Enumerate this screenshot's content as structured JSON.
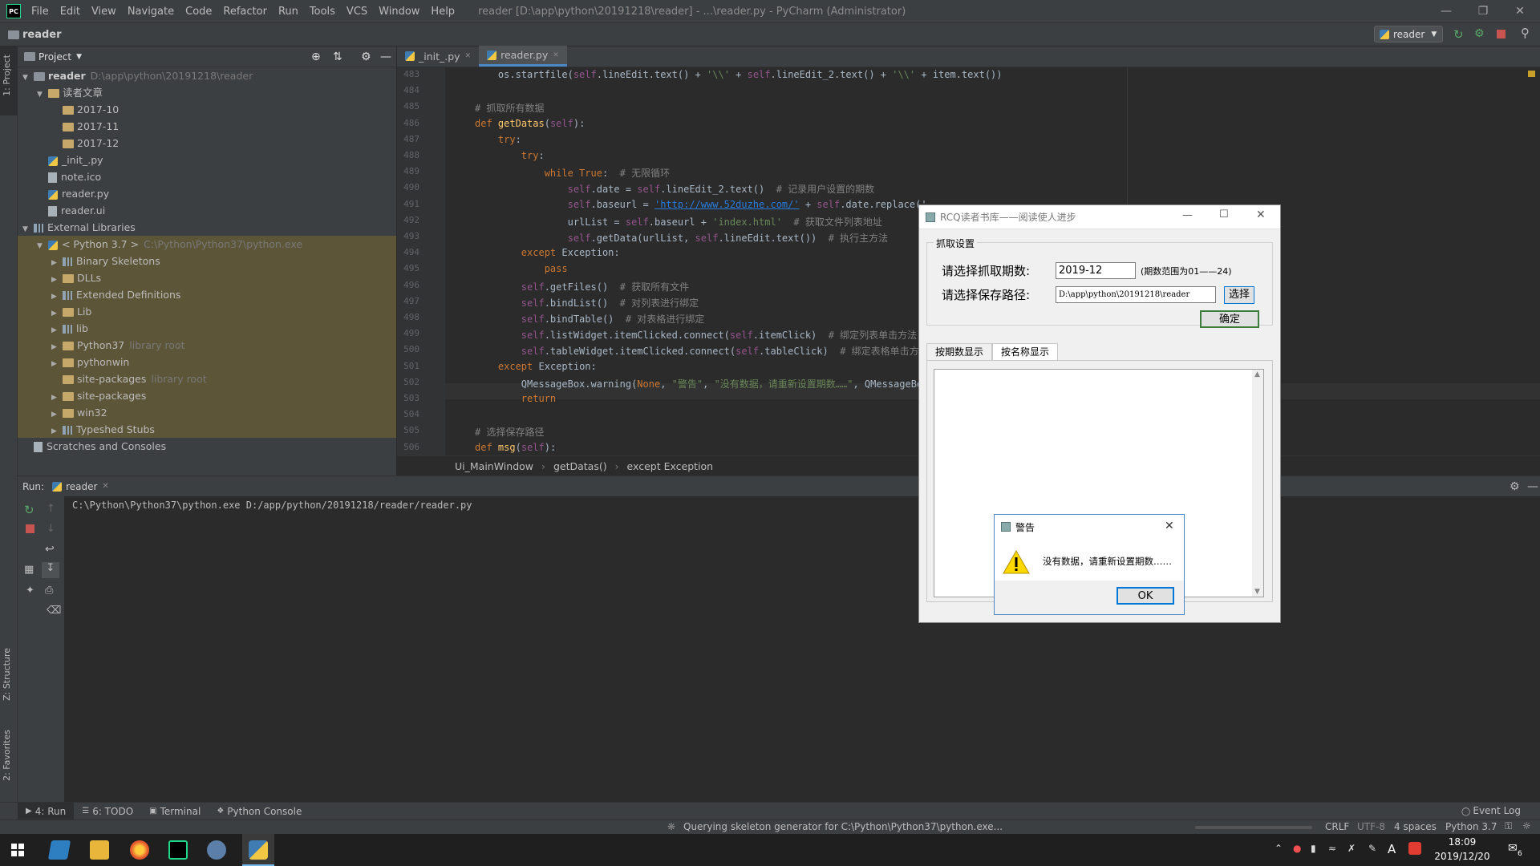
{
  "titlebar": {
    "app_icon": "PC",
    "menu": [
      "File",
      "Edit",
      "View",
      "Navigate",
      "Code",
      "Refactor",
      "Run",
      "Tools",
      "VCS",
      "Window",
      "Help"
    ],
    "window_title": "reader [D:\\app\\python\\20191218\\reader] - ...\\reader.py - PyCharm (Administrator)"
  },
  "navbar": {
    "project_name": "reader",
    "run_config": "reader"
  },
  "sidebar_tabs": {
    "project": "1: Project",
    "structure": "Z: Structure",
    "favorites": "2: Favorites"
  },
  "project_panel": {
    "header": "Project",
    "tree": [
      {
        "label": "reader",
        "extra": "D:\\app\\python\\20191218\\reader",
        "kind": "folder",
        "indent": 0,
        "arrow": "▼"
      },
      {
        "label": "读者文章",
        "kind": "folder",
        "indent": 1,
        "arrow": "▼"
      },
      {
        "label": "2017-10",
        "kind": "folder",
        "indent": 2,
        "arrow": ""
      },
      {
        "label": "2017-11",
        "kind": "folder",
        "indent": 2,
        "arrow": ""
      },
      {
        "label": "2017-12",
        "kind": "folder",
        "indent": 2,
        "arrow": ""
      },
      {
        "label": "_init_.py",
        "kind": "py",
        "indent": 1,
        "arrow": ""
      },
      {
        "label": "note.ico",
        "kind": "file",
        "indent": 1,
        "arrow": ""
      },
      {
        "label": "reader.py",
        "kind": "py",
        "indent": 1,
        "arrow": ""
      },
      {
        "label": "reader.ui",
        "kind": "file",
        "indent": 1,
        "arrow": ""
      },
      {
        "label": "External Libraries",
        "kind": "lib",
        "indent": 0,
        "arrow": "▼"
      },
      {
        "label": "< Python 3.7 >",
        "extra": "C:\\Python\\Python37\\python.exe",
        "kind": "py",
        "indent": 1,
        "arrow": "▼",
        "lib": true
      },
      {
        "label": "Binary Skeletons",
        "kind": "lib",
        "indent": 2,
        "arrow": "▶",
        "lib": true
      },
      {
        "label": "DLLs",
        "kind": "folder",
        "indent": 2,
        "arrow": "▶",
        "lib": true
      },
      {
        "label": "Extended Definitions",
        "kind": "lib",
        "indent": 2,
        "arrow": "▶",
        "lib": true
      },
      {
        "label": "Lib",
        "kind": "folder",
        "indent": 2,
        "arrow": "▶",
        "lib": true
      },
      {
        "label": "lib",
        "kind": "lib",
        "indent": 2,
        "arrow": "▶",
        "lib": true
      },
      {
        "label": "Python37",
        "extra": "library root",
        "kind": "folder",
        "indent": 2,
        "arrow": "▶",
        "lib": true
      },
      {
        "label": "pythonwin",
        "kind": "folder",
        "indent": 2,
        "arrow": "▶",
        "lib": true
      },
      {
        "label": "site-packages",
        "extra": "library root",
        "kind": "folder",
        "indent": 2,
        "arrow": "",
        "lib": true
      },
      {
        "label": "site-packages",
        "kind": "folder",
        "indent": 2,
        "arrow": "▶",
        "lib": true
      },
      {
        "label": "win32",
        "kind": "folder",
        "indent": 2,
        "arrow": "▶",
        "lib": true
      },
      {
        "label": "Typeshed Stubs",
        "kind": "lib",
        "indent": 2,
        "arrow": "▶",
        "lib": true
      },
      {
        "label": "Scratches and Consoles",
        "kind": "file",
        "indent": 0,
        "arrow": ""
      }
    ]
  },
  "editor": {
    "tabs": [
      {
        "label": "_init_.py",
        "active": false
      },
      {
        "label": "reader.py",
        "active": true
      }
    ],
    "lines": [
      {
        "n": "483",
        "html": "    os.startfile(<span class=\"self\">self</span>.lineEdit.text() + <span class=\"str\">'\\\\'</span> + <span class=\"self\">self</span>.lineEdit_2.text() + <span class=\"str\">'\\\\'</span> + item.text())"
      },
      {
        "n": "484",
        "html": ""
      },
      {
        "n": "485",
        "html": "<span class=\"cm\"># 抓取所有数据</span>"
      },
      {
        "n": "486",
        "html": "<span class=\"kw\">def</span> <span class=\"fn\">getDatas</span>(<span class=\"self\">self</span>):"
      },
      {
        "n": "487",
        "html": "    <span class=\"kw\">try</span>:"
      },
      {
        "n": "488",
        "html": "        <span class=\"kw\">try</span>:"
      },
      {
        "n": "489",
        "html": "            <span class=\"kw\">while True</span>:  <span class=\"cm\"># 无限循环</span>"
      },
      {
        "n": "490",
        "html": "                <span class=\"self\">self</span>.date = <span class=\"self\">self</span>.lineEdit_2.text()  <span class=\"cm\"># 记录用户设置的期数</span>"
      },
      {
        "n": "491",
        "html": "                <span class=\"self\">self</span>.baseurl = <span class=\"url\">'http://www.52duzhe.com/'</span> + <span class=\"self\">self</span>.date.replace('-"
      },
      {
        "n": "492",
        "html": "                urlList = <span class=\"self\">self</span>.baseurl + <span class=\"str\">'index.html'</span>  <span class=\"cm\"># 获取文件列表地址</span>"
      },
      {
        "n": "493",
        "html": "                <span class=\"self\">self</span>.getData(urlList, <span class=\"self\">self</span>.lineEdit.text())  <span class=\"cm\"># 执行主方法</span>"
      },
      {
        "n": "494",
        "html": "        <span class=\"kw\">except</span> Exception:"
      },
      {
        "n": "495",
        "html": "            <span class=\"kw\">pass</span>"
      },
      {
        "n": "496",
        "html": "        <span class=\"self\">self</span>.getFiles()  <span class=\"cm\"># 获取所有文件</span>"
      },
      {
        "n": "497",
        "html": "        <span class=\"self\">self</span>.bindList()  <span class=\"cm\"># 对列表进行绑定</span>"
      },
      {
        "n": "498",
        "html": "        <span class=\"self\">self</span>.bindTable()  <span class=\"cm\"># 对表格进行绑定</span>"
      },
      {
        "n": "499",
        "html": "        <span class=\"self\">self</span>.listWidget.itemClicked.connect(<span class=\"self\">self</span>.itemClick)  <span class=\"cm\"># 绑定列表单击方法</span>"
      },
      {
        "n": "500",
        "html": "        <span class=\"self\">self</span>.tableWidget.itemClicked.connect(<span class=\"self\">self</span>.tableClick)  <span class=\"cm\"># 绑定表格单击方法</span>"
      },
      {
        "n": "501",
        "html": "    <span class=\"kw\">except</span> Exception:"
      },
      {
        "n": "502",
        "html": "        QMessageBox.warning(<span class=\"kw\">None</span>, <span class=\"str\">\"警告\"</span>, <span class=\"str\">\"没有数据，请重新设置期数……\"</span>, QMessageBo"
      },
      {
        "n": "503",
        "html": "        <span class=\"kw\">return</span>"
      },
      {
        "n": "504",
        "html": ""
      },
      {
        "n": "505",
        "html": "<span class=\"cm\"># 选择保存路径</span>"
      },
      {
        "n": "506",
        "html": "<span class=\"kw\">def</span> <span class=\"fn\">msg</span>(<span class=\"self\">self</span>):"
      }
    ],
    "breadcrumb": [
      "Ui_MainWindow",
      "getDatas()",
      "except Exception"
    ]
  },
  "run": {
    "label": "Run:",
    "tab": "reader",
    "command": "C:\\Python\\Python37\\python.exe D:/app/python/20191218/reader/reader.py"
  },
  "bottom_tabs": [
    "4: Run",
    "6: TODO",
    "Terminal",
    "Python Console"
  ],
  "event_log": "Event Log",
  "status": {
    "message": "Querying skeleton generator for C:\\Python\\Python37\\python.exe...",
    "line_sep": "CRLF",
    "encoding": "UTF-8",
    "indent": "4 spaces",
    "interpreter": "Python 3.7"
  },
  "taskbar": {
    "time": "18:09",
    "date": "2019/12/20",
    "ime": "A",
    "notif_count": "6"
  },
  "qt_app": {
    "title": "RCQ读者书库——阅读使人进步",
    "group": "抓取设置",
    "period_label": "请选择抓取期数:",
    "period_value": "2019-12",
    "period_hint": "(期数范围为01——24)",
    "path_label": "请选择保存路径:",
    "path_value": "D:\\app\\python\\20191218\\reader",
    "choose_btn": "选择",
    "ok_btn": "确定",
    "tabs": [
      "按期数显示",
      "按名称显示"
    ]
  },
  "qt_warning": {
    "title": "警告",
    "message": "没有数据，请重新设置期数……",
    "ok": "OK"
  }
}
